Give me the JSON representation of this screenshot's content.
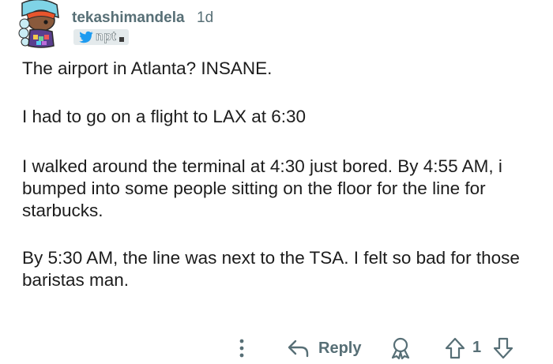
{
  "comment": {
    "author": "tekashimandela",
    "age": "1d",
    "flair": {
      "icon": "twitter-bird-icon",
      "text": "npt"
    },
    "paragraphs": [
      "The airport in Atlanta? INSANE.",
      "I had to go on a flight to LAX at 6:30",
      "I walked around the terminal at 4:30 just bored. By 4:55 AM, i bumped into some people sitting on the floor for the line for starbucks.",
      "By 5:30 AM, the line was next to the TSA. I felt so bad for those baristas man."
    ]
  },
  "actions": {
    "more_icon": "more-vertical-icon",
    "reply_icon": "reply-arrow-icon",
    "reply_label": "Reply",
    "award_icon": "award-icon",
    "upvote_icon": "upvote-arrow-icon",
    "vote_count": "1",
    "downvote_icon": "downvote-arrow-icon"
  },
  "colors": {
    "meta_text": "#576f76",
    "body_text": "#1c1c1c",
    "flair_bg": "#e4eaec",
    "twitter_blue": "#1d9bf0"
  }
}
